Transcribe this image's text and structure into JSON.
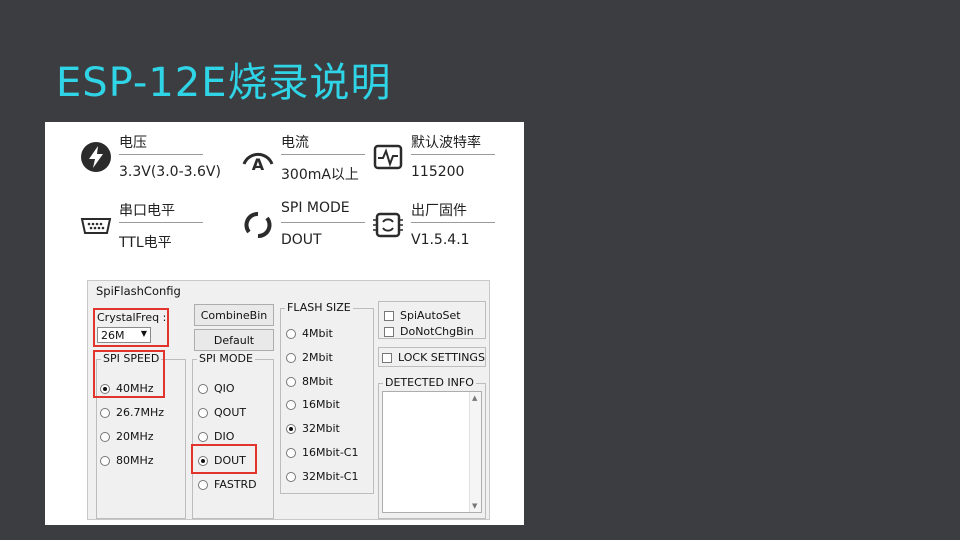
{
  "slide": {
    "title": "ESP-12E烧录说明"
  },
  "specs": [
    {
      "label": "电压",
      "value": "3.3V(3.0-3.6V)",
      "icon": "lightning-icon"
    },
    {
      "label": "电流",
      "value": "300mA以上",
      "icon": "ammeter-icon"
    },
    {
      "label": "默认波特率",
      "value": "115200",
      "icon": "waveform-icon"
    },
    {
      "label": "串口电平",
      "value": "TTL电平",
      "icon": "serial-port-icon"
    },
    {
      "label": "SPI MODE",
      "value": "DOUT",
      "icon": "spin-icon"
    },
    {
      "label": "出厂固件",
      "value": "V1.5.4.1",
      "icon": "firmware-chip-icon"
    }
  ],
  "dialog": {
    "title": "SpiFlashConfig",
    "crystal": {
      "label": "CrystalFreq :",
      "value": "26M"
    },
    "spi_speed": {
      "caption": "SPI SPEED",
      "options": [
        "40MHz",
        "26.7MHz",
        "20MHz",
        "80MHz"
      ],
      "selected": "40MHz"
    },
    "buttons": {
      "combine": "CombineBin",
      "default": "Default"
    },
    "spi_mode": {
      "caption": "SPI MODE",
      "options": [
        "QIO",
        "QOUT",
        "DIO",
        "DOUT",
        "FASTRD"
      ],
      "selected": "DOUT"
    },
    "flash_size": {
      "caption": "FLASH SIZE",
      "options": [
        "4Mbit",
        "2Mbit",
        "8Mbit",
        "16Mbit",
        "32Mbit",
        "16Mbit-C1",
        "32Mbit-C1"
      ],
      "selected": "32Mbit"
    },
    "checks": {
      "auto_set": "SpiAutoSet",
      "no_chg": "DoNotChgBin",
      "lock": "LOCK SETTINGS"
    },
    "detected": {
      "caption": "DETECTED INFO"
    },
    "highlight_color": "#e0342c"
  }
}
